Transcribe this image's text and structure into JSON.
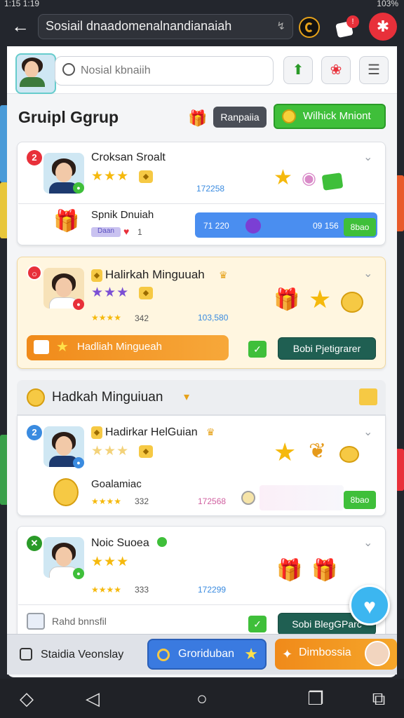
{
  "status": {
    "time": "1:15 1:19",
    "battery": "103%"
  },
  "browser": {
    "back": "←",
    "url": "Sosiail dnaadomenalnandianaiah",
    "url_icon": "↯"
  },
  "header": {
    "search_placeholder": "Nosial kbnaiih"
  },
  "group": {
    "title": "Gruipl Ggrup",
    "gray_button": "Ranpaiia",
    "green_button": "Wilhick Mniont"
  },
  "cards": [
    {
      "num": "2",
      "name": "Croksan Sroalt",
      "stars": "★★★",
      "id": "172258",
      "sub_name": "Spnik Dnuiah",
      "sub_tag": "Daan",
      "sub_likes": "1",
      "bar_left": "71 220",
      "bar_right": "09 156",
      "bar_button": "8bao"
    },
    {
      "num": "○",
      "name": "Halirkah Minguuah",
      "stars": "★★★",
      "small_stars": "★★★★",
      "count": "342",
      "id": "103,580",
      "orange_label": "Hadliah Mingueah",
      "dark_button": "Bobi Pjetigrarer"
    },
    {
      "num": "2",
      "name": "Hadirkar HelGuian",
      "stars": "★★★",
      "small_stars": "★★★★",
      "count": "332",
      "id": "172568",
      "sub_name": "Goalamiac",
      "button": "8bao"
    },
    {
      "num": "✕",
      "name": "Noic Suoea",
      "stars": "★★★",
      "small_stars": "★★★★",
      "count": "333",
      "id": "172299",
      "sub_name": "Rahd bnnsfil",
      "dark_button": "Sobi BlegGParc"
    }
  ],
  "section": {
    "title": "Hadkah Minguiuan"
  },
  "bottom": {
    "left": "Staidia Veonslay",
    "middle": "Groriduban",
    "right": "Dimbossia"
  },
  "colors": {
    "green": "#3fbf3a",
    "blue": "#4a8ef0",
    "orange": "#f08a1a",
    "red": "#e8303a"
  }
}
